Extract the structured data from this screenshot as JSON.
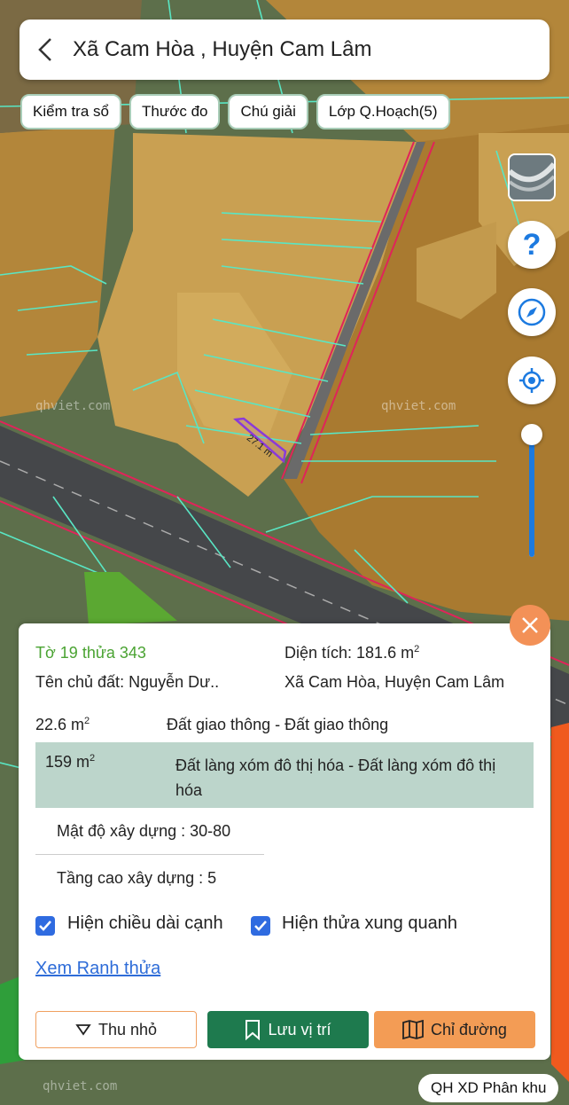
{
  "header": {
    "title": "Xã Cam Hòa , Huyện Cam Lâm"
  },
  "chips": [
    {
      "label": "Kiểm tra sổ"
    },
    {
      "label": "Thước đo"
    },
    {
      "label": "Chú giải"
    },
    {
      "label": "Lớp Q.Hoạch(5)"
    }
  ],
  "map": {
    "watermark": "qhviet.com",
    "measure_label": "27.1 m",
    "colors": {
      "land": "#b3863a",
      "land_light": "#c9a052",
      "parcel_line": "#59e6c4",
      "road_line": "#e0245a",
      "green_zone": "#5ba832",
      "orange_zone": "#f05a1e",
      "selected_parcel": "#8a3ad8"
    }
  },
  "controls": {
    "help_icon": "question-icon",
    "compass_icon": "compass-icon",
    "locate_icon": "locate-icon",
    "zoom_level": 0.95
  },
  "info": {
    "parcel_id": "Tờ 19 thửa 343",
    "area_label": "Diện tích: 181.6 m",
    "area_sup": "2",
    "owner": "Tên chủ đất: Nguyễn Dư..",
    "location": "Xã Cam Hòa, Huyện Cam Lâm",
    "zones": [
      {
        "area": "22.6 m",
        "sup": "2",
        "type": "Đất giao thông - Đất giao thông"
      },
      {
        "area": "159 m",
        "sup": "2",
        "type": "Đất làng xóm đô thị hóa - Đất làng xóm đô thị hóa"
      }
    ],
    "density": "Mật độ xây dựng : 30-80",
    "height": "Tầng cao xây dựng : 5",
    "show_edge_length": "Hiện chiều dài cạnh",
    "show_neighbors": "Hiện thửa xung quanh",
    "view_boundary": "Xem Ranh thửa"
  },
  "actions": {
    "shrink": "Thu nhỏ",
    "save": "Lưu vị trí",
    "route": "Chỉ đường"
  },
  "footer": {
    "zone_label": "QH XD Phân khu",
    "watermark": "qhviet.com"
  }
}
